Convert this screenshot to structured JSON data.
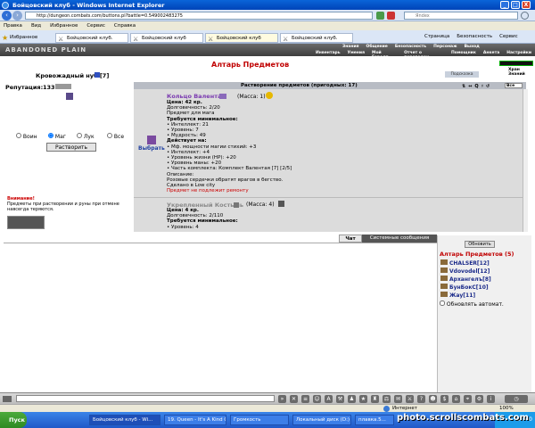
{
  "window": {
    "title": "Бойцовский клуб - Windows Internet Explorer",
    "min": "_",
    "max": "□",
    "close": "X"
  },
  "address": {
    "url": "http://dungeon.combats.com/buttons.pl?battle=0.549002483275",
    "search_placeholder": "Яndex"
  },
  "menu": [
    "Правка",
    "Вид",
    "Избранное",
    "Сервис",
    "Справка"
  ],
  "browser_tabs": {
    "favorites": "Избранное",
    "items": [
      "Бойцовский клуб.",
      "Бойцовский клуб",
      "Бойцовский клуб",
      "Бойцовский клуб."
    ],
    "tools": [
      "Страница",
      "Безопасность",
      "Сервис"
    ]
  },
  "game": {
    "logo": "ABANDONED PLAIN",
    "top_menu": [
      "Знания",
      "Общение",
      "Безопасность",
      "Персонаж",
      "Выход"
    ],
    "sub_menu": [
      "Инвентарь",
      "Умения",
      "Мой Горолп",
      "Отчет о переводах",
      "Помощник",
      "Анкета",
      "Настройки"
    ],
    "char_name": "Кровожадный нуб [7]",
    "reputation_label": "Репутация:",
    "reputation_value": "133",
    "filters": [
      "Воин",
      "Маг",
      "Лук",
      "Все"
    ],
    "filter_selected": "Маг",
    "disenchant_button": "Растворить",
    "warning_title": "Внимание!",
    "warning_text": "Предметы при растворении и руны при отмене навсегда теряются.",
    "altar_title": "Алтарь Предметов",
    "hint_button": "Подсказка",
    "keeper": "Хран Знаний",
    "list_title": "Растворение предметов (пригодных: 17)",
    "sort_select": "Все",
    "items": [
      {
        "name": "Кольцо Валентая",
        "mass": "(Масса: 1)",
        "choose": "Выбрать",
        "lines": [
          {
            "t": "Цена: 42 кр.",
            "bold": true
          },
          {
            "t": "Долговечность: 2/20"
          },
          {
            "t": "Предмет для мага"
          },
          {
            "t": "Требуется минимальное:",
            "bold": true
          },
          {
            "t": "• Интеллект: 21"
          },
          {
            "t": "• Уровень: 7"
          },
          {
            "t": "• Мудрость: 49"
          },
          {
            "t": "Действует на:",
            "bold": true
          },
          {
            "t": "• Мф. мощности магии стихий: +3"
          },
          {
            "t": "• Интеллект: +4"
          },
          {
            "t": "• Уровень жизни (HP): +20"
          },
          {
            "t": "• Уровень маны: +20"
          },
          {
            "t": "• Часть комплекта: Комплект Валентая [7] [2/5]"
          },
          {
            "t": "Описание:"
          },
          {
            "t": "Розовые сердечки обратят врагов в бегство."
          },
          {
            "t": "Сделано в Low city"
          },
          {
            "t": "Предмет не подлежит ремонту",
            "red": true
          }
        ]
      },
      {
        "name": "Укрепленный Костыль",
        "mass": "(Масса: 4)",
        "lines": [
          {
            "t": "Цена: 4 кр.",
            "bold": true
          },
          {
            "t": "Долговечность: 2/110"
          },
          {
            "t": "Требуется минимальное:",
            "bold": true
          },
          {
            "t": "• Уровень: 4"
          }
        ]
      }
    ],
    "chat_tab": "Чат",
    "system_tab": "Системные сообщения",
    "refresh_button": "Обновить",
    "room_title": "Алтарь Предметов (5)",
    "users": [
      "CHALSER[12]",
      "Vdovodel[12]",
      "Архангелъ[8]",
      "БунБокС[10]",
      "Жау[11]"
    ],
    "auto_refresh": "Обновлять автомат."
  },
  "status": {
    "zone": "Интернет",
    "zoom": "100%"
  },
  "taskbar": {
    "start": "Пуск",
    "tasks": [
      "Бойцовский клуб - Wi...",
      "19. Queen - It's A Kind O...",
      "Громкость",
      "Локальный диск (D:)",
      "плавка.5..."
    ],
    "watermark": "photo.scrollscombats.com",
    "time": "21:40"
  }
}
